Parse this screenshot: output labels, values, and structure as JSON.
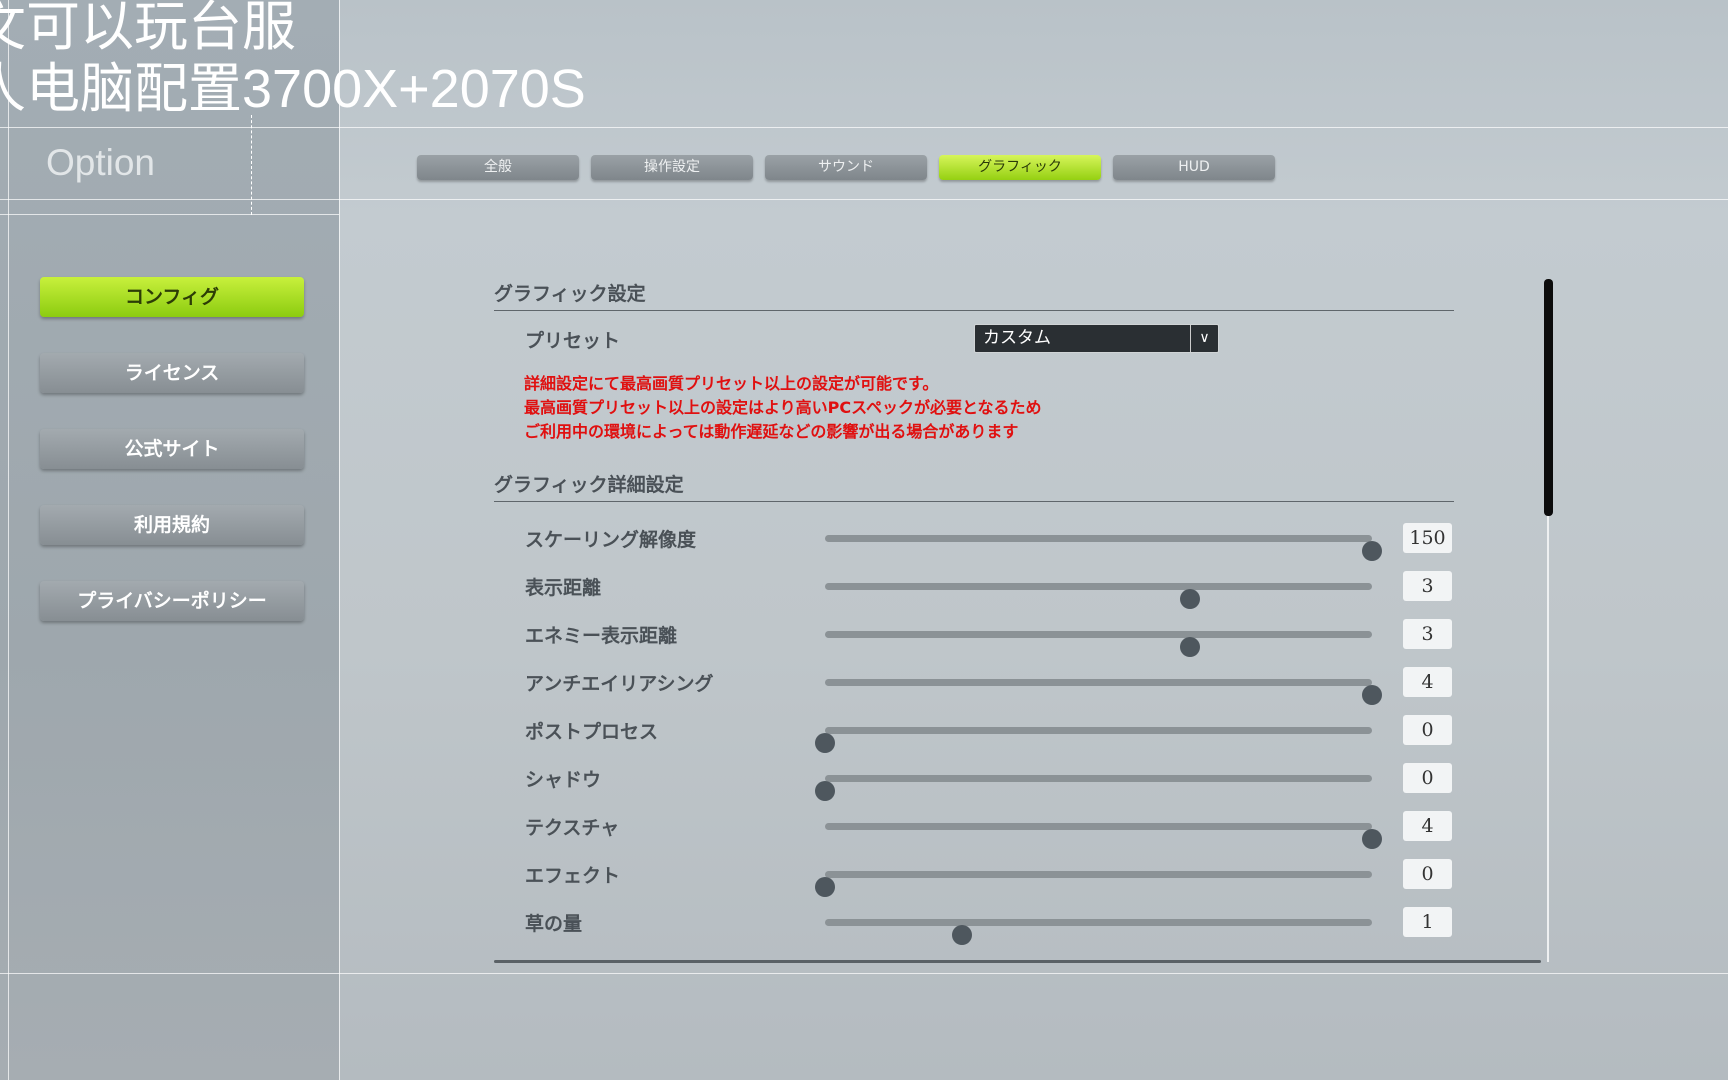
{
  "overlay": {
    "line1": "文可以玩台服",
    "line2_cn": "人电脑配置",
    "line2_spec": "3700X+2070S"
  },
  "header": {
    "title": "Option"
  },
  "tabs": [
    {
      "label": "全般"
    },
    {
      "label": "操作設定"
    },
    {
      "label": "サウンド"
    },
    {
      "label": "グラフィック",
      "active": true
    },
    {
      "label": "HUD"
    }
  ],
  "sidebar": {
    "items": [
      {
        "label": "コンフィグ",
        "active": true
      },
      {
        "label": "ライセンス"
      },
      {
        "label": "公式サイト"
      },
      {
        "label": "利用規約"
      },
      {
        "label": "プライバシーポリシー"
      }
    ]
  },
  "graphics": {
    "section_title": "グラフィック設定",
    "preset_label": "プリセット",
    "preset_value": "カスタム",
    "warnings": [
      "詳細設定にて最高画質プリセット以上の設定が可能です。",
      "最高画質プリセット以上の設定はより高いPCスペックが必要となるため",
      "ご利用中の環境によっては動作遅延などの影響が出る場合があります"
    ],
    "detail_title": "グラフィック詳細設定",
    "sliders": [
      {
        "label": "スケーリング解像度",
        "value": "150",
        "fraction": 1.0
      },
      {
        "label": "表示距離",
        "value": "3",
        "fraction": 0.667
      },
      {
        "label": "エネミー表示距離",
        "value": "3",
        "fraction": 0.667
      },
      {
        "label": "アンチエイリアシング",
        "value": "4",
        "fraction": 1.0
      },
      {
        "label": "ポストプロセス",
        "value": "0",
        "fraction": 0
      },
      {
        "label": "シャドウ",
        "value": "0",
        "fraction": 0
      },
      {
        "label": "テクスチャ",
        "value": "4",
        "fraction": 1.0
      },
      {
        "label": "エフェクト",
        "value": "0",
        "fraction": 0
      },
      {
        "label": "草の量",
        "value": "1",
        "fraction": 0.25
      }
    ]
  },
  "colors": {
    "accent": "#a8e020",
    "warning": "#e01010"
  }
}
